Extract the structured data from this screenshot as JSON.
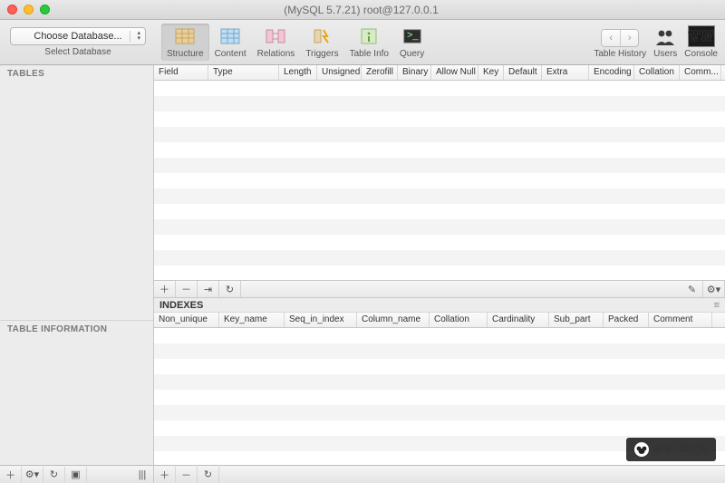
{
  "title": "(MySQL 5.7.21) root@127.0.0.1",
  "db": {
    "combo": "Choose Database...",
    "sub": "Select Database"
  },
  "tabs": {
    "structure": "Structure",
    "content": "Content",
    "relations": "Relations",
    "triggers": "Triggers",
    "tableinfo": "Table Info",
    "query": "Query"
  },
  "right": {
    "history": "Table History",
    "users": "Users",
    "console": "Console",
    "console_box": [
      "conso",
      "le off"
    ]
  },
  "sidebar": {
    "tables": "TABLES",
    "tableinfo": "TABLE INFORMATION"
  },
  "fields_cols": [
    "Field",
    "Type",
    "Length",
    "Unsigned",
    "Zerofill",
    "Binary",
    "Allow Null",
    "Key",
    "Default",
    "Extra",
    "Encoding",
    "Collation",
    "Comm..."
  ],
  "fields_widths": [
    60,
    78,
    42,
    49,
    40,
    37,
    52,
    28,
    42,
    52,
    50,
    50,
    46
  ],
  "indexes_label": "INDEXES",
  "index_cols": [
    "Non_unique",
    "Key_name",
    "Seq_in_index",
    "Column_name",
    "Collation",
    "Cardinality",
    "Sub_part",
    "Packed",
    "Comment"
  ],
  "index_widths": [
    72,
    72,
    80,
    80,
    64,
    68,
    60,
    50,
    70
  ],
  "watermark": {
    "brand": "php",
    "cn": "中文网"
  }
}
